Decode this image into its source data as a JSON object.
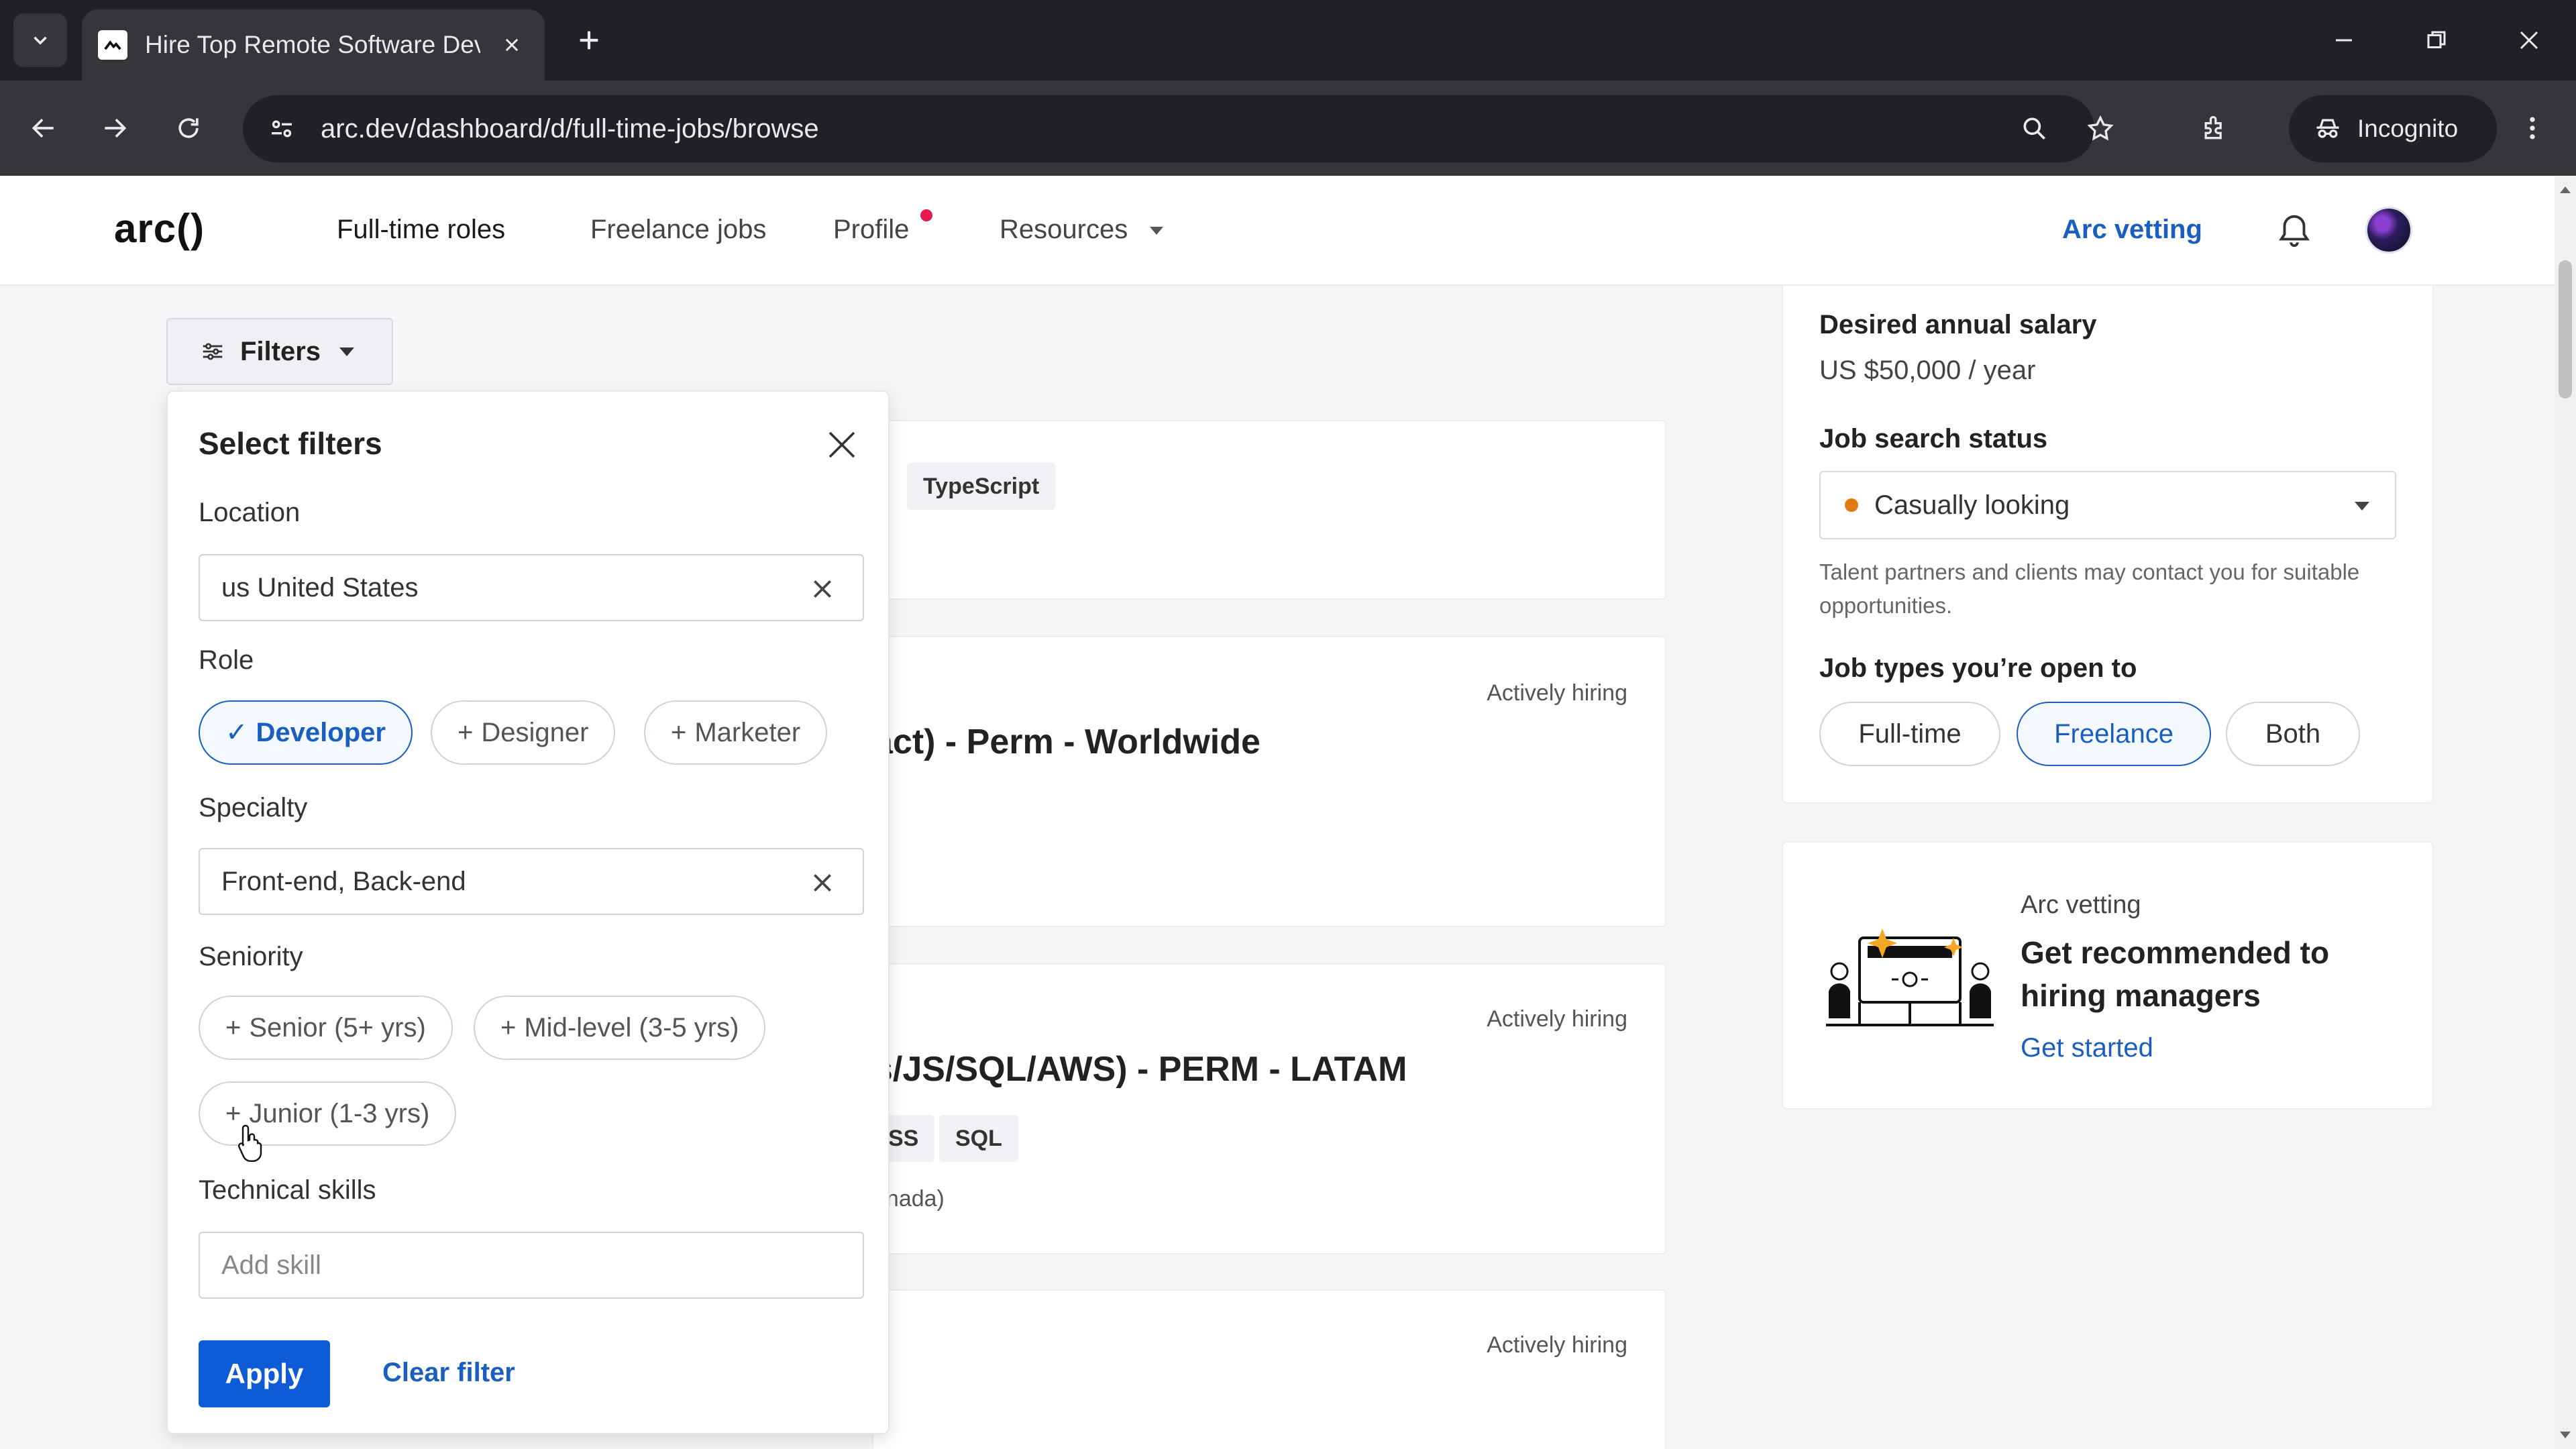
{
  "browser": {
    "tab_title": "Hire Top Remote Software Developers",
    "url": "arc.dev/dashboard/d/full-time-jobs/browse",
    "incognito_label": "Incognito"
  },
  "header": {
    "logo": "arc()",
    "nav": {
      "full_time": "Full-time roles",
      "freelance": "Freelance jobs",
      "profile": "Profile",
      "resources": "Resources"
    },
    "arc_vetting": "Arc vetting"
  },
  "filters_button": "Filters",
  "filter_panel": {
    "title": "Select filters",
    "location_label": "Location",
    "location_value": "us United States",
    "role_label": "Role",
    "roles": {
      "developer": "Developer",
      "designer": "Designer",
      "marketer": "Marketer"
    },
    "specialty_label": "Specialty",
    "specialty_value": "Front-end, Back-end",
    "seniority_label": "Seniority",
    "seniority": {
      "senior": "Senior (5+ yrs)",
      "mid": "Mid-level (3-5 yrs)",
      "junior": "Junior (1-3 yrs)"
    },
    "skills_label": "Technical skills",
    "skills_placeholder": "Add skill",
    "apply": "Apply",
    "clear": "Clear filter"
  },
  "jobs": {
    "card1_chip": "TypeScript",
    "card2_status": "Actively hiring",
    "card2_title": "act) - Perm - Worldwide",
    "card3_status": "Actively hiring",
    "card3_title": "s/JS/SQL/AWS) - PERM - LATAM",
    "card3_chip1": "SS",
    "card3_chip2": "SQL",
    "card3_sub": "anada)",
    "card4_status": "Actively hiring"
  },
  "sidebar": {
    "salary_label": "Desired annual salary",
    "salary_value": "US $50,000 / year",
    "status_label": "Job search status",
    "status_value": "Casually looking",
    "status_help": "Talent partners and clients may contact you for suitable opportunities.",
    "types_label": "Job types you’re open to",
    "types": {
      "full_time": "Full-time",
      "freelance": "Freelance",
      "both": "Both"
    }
  },
  "vetting_card": {
    "eyebrow": "Arc vetting",
    "title": "Get recommended to hiring managers",
    "link": "Get started"
  },
  "colors": {
    "accent": "#1a5fbf",
    "apply_button": "#0d5bd7",
    "status_dot": "#e07a10",
    "profile_dot": "#e6194b"
  }
}
